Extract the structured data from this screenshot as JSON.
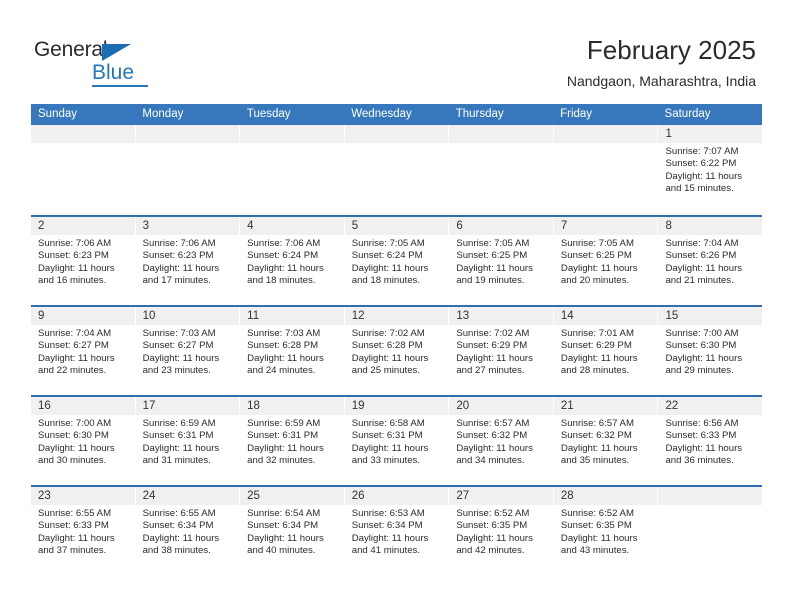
{
  "brand": {
    "name_top": "General",
    "name_bottom": "Blue",
    "triangle_color": "#1b6cb3",
    "blue_color": "#2377ba"
  },
  "header": {
    "title": "February 2025",
    "subtitle": "Nandgaon, Maharashtra, India"
  },
  "theme": {
    "header_blue": "#3778bc",
    "row_divider_blue": "#2f6fb0",
    "daynum_band": "#f0f0f0",
    "text": "#2b2b2b"
  },
  "weekdays": [
    "Sunday",
    "Monday",
    "Tuesday",
    "Wednesday",
    "Thursday",
    "Friday",
    "Saturday"
  ],
  "labels": {
    "sunrise_prefix": "Sunrise: ",
    "sunset_prefix": "Sunset: ",
    "daylight_prefix": "Daylight: "
  },
  "weeks": [
    [
      {
        "day": "",
        "sunrise": "",
        "sunset": "",
        "daylight": ""
      },
      {
        "day": "",
        "sunrise": "",
        "sunset": "",
        "daylight": ""
      },
      {
        "day": "",
        "sunrise": "",
        "sunset": "",
        "daylight": ""
      },
      {
        "day": "",
        "sunrise": "",
        "sunset": "",
        "daylight": ""
      },
      {
        "day": "",
        "sunrise": "",
        "sunset": "",
        "daylight": ""
      },
      {
        "day": "",
        "sunrise": "",
        "sunset": "",
        "daylight": ""
      },
      {
        "day": "1",
        "sunrise": "Sunrise: 7:07 AM",
        "sunset": "Sunset: 6:22 PM",
        "daylight": "Daylight: 11 hours and 15 minutes."
      }
    ],
    [
      {
        "day": "2",
        "sunrise": "Sunrise: 7:06 AM",
        "sunset": "Sunset: 6:23 PM",
        "daylight": "Daylight: 11 hours and 16 minutes."
      },
      {
        "day": "3",
        "sunrise": "Sunrise: 7:06 AM",
        "sunset": "Sunset: 6:23 PM",
        "daylight": "Daylight: 11 hours and 17 minutes."
      },
      {
        "day": "4",
        "sunrise": "Sunrise: 7:06 AM",
        "sunset": "Sunset: 6:24 PM",
        "daylight": "Daylight: 11 hours and 18 minutes."
      },
      {
        "day": "5",
        "sunrise": "Sunrise: 7:05 AM",
        "sunset": "Sunset: 6:24 PM",
        "daylight": "Daylight: 11 hours and 18 minutes."
      },
      {
        "day": "6",
        "sunrise": "Sunrise: 7:05 AM",
        "sunset": "Sunset: 6:25 PM",
        "daylight": "Daylight: 11 hours and 19 minutes."
      },
      {
        "day": "7",
        "sunrise": "Sunrise: 7:05 AM",
        "sunset": "Sunset: 6:25 PM",
        "daylight": "Daylight: 11 hours and 20 minutes."
      },
      {
        "day": "8",
        "sunrise": "Sunrise: 7:04 AM",
        "sunset": "Sunset: 6:26 PM",
        "daylight": "Daylight: 11 hours and 21 minutes."
      }
    ],
    [
      {
        "day": "9",
        "sunrise": "Sunrise: 7:04 AM",
        "sunset": "Sunset: 6:27 PM",
        "daylight": "Daylight: 11 hours and 22 minutes."
      },
      {
        "day": "10",
        "sunrise": "Sunrise: 7:03 AM",
        "sunset": "Sunset: 6:27 PM",
        "daylight": "Daylight: 11 hours and 23 minutes."
      },
      {
        "day": "11",
        "sunrise": "Sunrise: 7:03 AM",
        "sunset": "Sunset: 6:28 PM",
        "daylight": "Daylight: 11 hours and 24 minutes."
      },
      {
        "day": "12",
        "sunrise": "Sunrise: 7:02 AM",
        "sunset": "Sunset: 6:28 PM",
        "daylight": "Daylight: 11 hours and 25 minutes."
      },
      {
        "day": "13",
        "sunrise": "Sunrise: 7:02 AM",
        "sunset": "Sunset: 6:29 PM",
        "daylight": "Daylight: 11 hours and 27 minutes."
      },
      {
        "day": "14",
        "sunrise": "Sunrise: 7:01 AM",
        "sunset": "Sunset: 6:29 PM",
        "daylight": "Daylight: 11 hours and 28 minutes."
      },
      {
        "day": "15",
        "sunrise": "Sunrise: 7:00 AM",
        "sunset": "Sunset: 6:30 PM",
        "daylight": "Daylight: 11 hours and 29 minutes."
      }
    ],
    [
      {
        "day": "16",
        "sunrise": "Sunrise: 7:00 AM",
        "sunset": "Sunset: 6:30 PM",
        "daylight": "Daylight: 11 hours and 30 minutes."
      },
      {
        "day": "17",
        "sunrise": "Sunrise: 6:59 AM",
        "sunset": "Sunset: 6:31 PM",
        "daylight": "Daylight: 11 hours and 31 minutes."
      },
      {
        "day": "18",
        "sunrise": "Sunrise: 6:59 AM",
        "sunset": "Sunset: 6:31 PM",
        "daylight": "Daylight: 11 hours and 32 minutes."
      },
      {
        "day": "19",
        "sunrise": "Sunrise: 6:58 AM",
        "sunset": "Sunset: 6:31 PM",
        "daylight": "Daylight: 11 hours and 33 minutes."
      },
      {
        "day": "20",
        "sunrise": "Sunrise: 6:57 AM",
        "sunset": "Sunset: 6:32 PM",
        "daylight": "Daylight: 11 hours and 34 minutes."
      },
      {
        "day": "21",
        "sunrise": "Sunrise: 6:57 AM",
        "sunset": "Sunset: 6:32 PM",
        "daylight": "Daylight: 11 hours and 35 minutes."
      },
      {
        "day": "22",
        "sunrise": "Sunrise: 6:56 AM",
        "sunset": "Sunset: 6:33 PM",
        "daylight": "Daylight: 11 hours and 36 minutes."
      }
    ],
    [
      {
        "day": "23",
        "sunrise": "Sunrise: 6:55 AM",
        "sunset": "Sunset: 6:33 PM",
        "daylight": "Daylight: 11 hours and 37 minutes."
      },
      {
        "day": "24",
        "sunrise": "Sunrise: 6:55 AM",
        "sunset": "Sunset: 6:34 PM",
        "daylight": "Daylight: 11 hours and 38 minutes."
      },
      {
        "day": "25",
        "sunrise": "Sunrise: 6:54 AM",
        "sunset": "Sunset: 6:34 PM",
        "daylight": "Daylight: 11 hours and 40 minutes."
      },
      {
        "day": "26",
        "sunrise": "Sunrise: 6:53 AM",
        "sunset": "Sunset: 6:34 PM",
        "daylight": "Daylight: 11 hours and 41 minutes."
      },
      {
        "day": "27",
        "sunrise": "Sunrise: 6:52 AM",
        "sunset": "Sunset: 6:35 PM",
        "daylight": "Daylight: 11 hours and 42 minutes."
      },
      {
        "day": "28",
        "sunrise": "Sunrise: 6:52 AM",
        "sunset": "Sunset: 6:35 PM",
        "daylight": "Daylight: 11 hours and 43 minutes."
      },
      {
        "day": "",
        "sunrise": "",
        "sunset": "",
        "daylight": ""
      }
    ]
  ]
}
